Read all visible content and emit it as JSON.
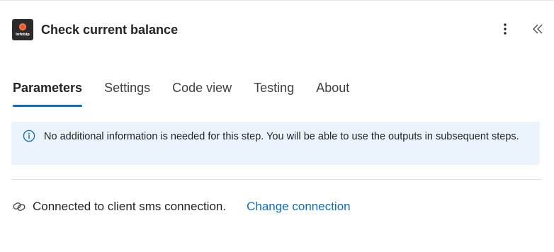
{
  "header": {
    "logo_text": "infobip",
    "title": "Check current balance",
    "more_icon": "more-vertical-icon",
    "collapse_icon": "double-chevron-left-icon"
  },
  "tabs": [
    {
      "label": "Parameters",
      "active": true
    },
    {
      "label": "Settings",
      "active": false
    },
    {
      "label": "Code view",
      "active": false
    },
    {
      "label": "Testing",
      "active": false
    },
    {
      "label": "About",
      "active": false
    }
  ],
  "info": {
    "icon": "info-icon",
    "message": "No additional information is needed for this step. You will be able to use the outputs in subsequent steps."
  },
  "connection": {
    "icon": "link-icon",
    "status_text": "Connected to client sms connection.",
    "change_label": "Change connection"
  },
  "colors": {
    "accent": "#0f6cbd",
    "info_background": "#ebf3fc",
    "logo_background": "#2b2b2b",
    "logo_accent": "#e8562a"
  }
}
